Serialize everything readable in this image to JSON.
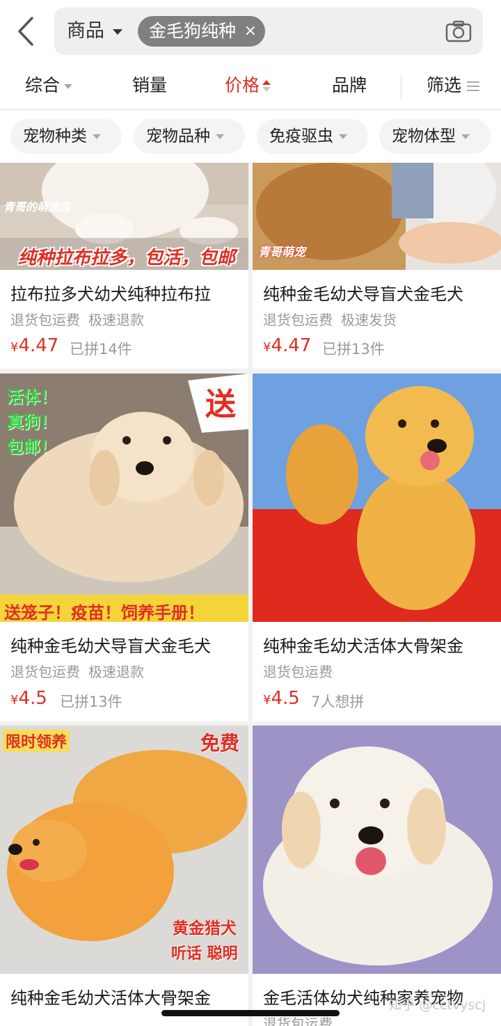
{
  "search": {
    "scope": "商品",
    "query": "金毛狗纯种",
    "clear": "×"
  },
  "sort_tabs": [
    {
      "label": "综合"
    },
    {
      "label": "销量"
    },
    {
      "label": "价格"
    },
    {
      "label": "品牌"
    },
    {
      "label": "筛选"
    }
  ],
  "filter_pills": [
    "宠物种类",
    "宠物品种",
    "免疫驱虫",
    "宠物体型"
  ],
  "products": [
    {
      "title": "拉布拉多犬幼犬纯种拉布拉",
      "tags": [
        "退货包运费",
        "极速退款"
      ],
      "currency": "¥",
      "price": "4.47",
      "sold": "已拼14件",
      "overlay_texts": [
        "青哥的萌宠店",
        "纯种拉布拉多，包活，包邮"
      ]
    },
    {
      "title": "纯种金毛幼犬导盲犬金毛犬",
      "tags": [
        "退货包运费",
        "极速发货"
      ],
      "currency": "¥",
      "price": "4.47",
      "sold": "已拼13件",
      "overlay_texts": [
        "青哥萌宠"
      ]
    },
    {
      "title": "纯种金毛幼犬导盲犬金毛犬",
      "tags": [
        "退货包运费",
        "极速退款"
      ],
      "currency": "¥",
      "price": "4.5",
      "sold": "已拼13件",
      "overlay_texts": [
        "活体！",
        "真狗！",
        "包邮！",
        "送",
        "送笼子！疫苗！饲养手册！"
      ]
    },
    {
      "title": "纯种金毛幼犬活体大骨架金",
      "tags": [
        "退货包运费"
      ],
      "currency": "¥",
      "price": "4.5",
      "sold": "7人想拼",
      "overlay_texts": []
    },
    {
      "title": "纯种金毛幼犬活体大骨架金",
      "tags": [],
      "currency": "",
      "price": "",
      "sold": "",
      "overlay_texts": [
        "限时领养",
        "免费",
        "黄金猎犬",
        "听话 聪明"
      ]
    },
    {
      "title": "金毛活体幼犬纯种家养宠物",
      "tags": [
        "退货包运费"
      ],
      "currency": "",
      "price": "",
      "sold": "",
      "overlay_texts": []
    }
  ],
  "watermark": "知乎 @cctvyscj",
  "colors": {
    "accent": "#e02e24",
    "chip": "#808080",
    "page_bg": "#f2f2f2"
  }
}
